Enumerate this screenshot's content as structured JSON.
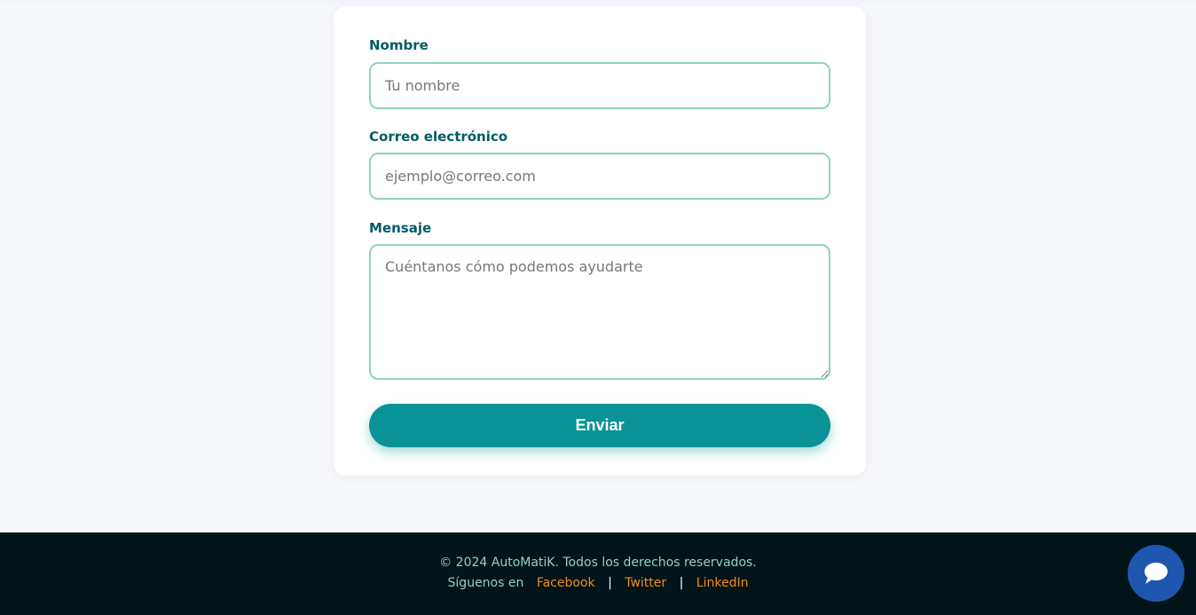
{
  "form": {
    "name_label": "Nombre",
    "name_placeholder": "Tu nombre",
    "name_value": "",
    "email_label": "Correo electrónico",
    "email_placeholder": "ejemplo@correo.com",
    "email_value": "",
    "message_label": "Mensaje",
    "message_placeholder": "Cuéntanos cómo podemos ayudarte",
    "message_value": "",
    "submit_label": "Enviar"
  },
  "footer": {
    "copyright": "© 2024 AutoMatiK. Todos los derechos reservados.",
    "follow_text": "Síguenos en",
    "links": [
      "Facebook",
      "Twitter",
      "LinkedIn"
    ],
    "separator": "|"
  },
  "chat_widget": {
    "icon": "chat-bubble-icon"
  },
  "colors": {
    "accent": "#0a9396",
    "label": "#005d66",
    "input_border": "#8fd3c1",
    "footer_bg": "#00141a",
    "footer_text": "#94d2bd",
    "link": "#f28c18",
    "chat_button": "#1f57b0"
  }
}
